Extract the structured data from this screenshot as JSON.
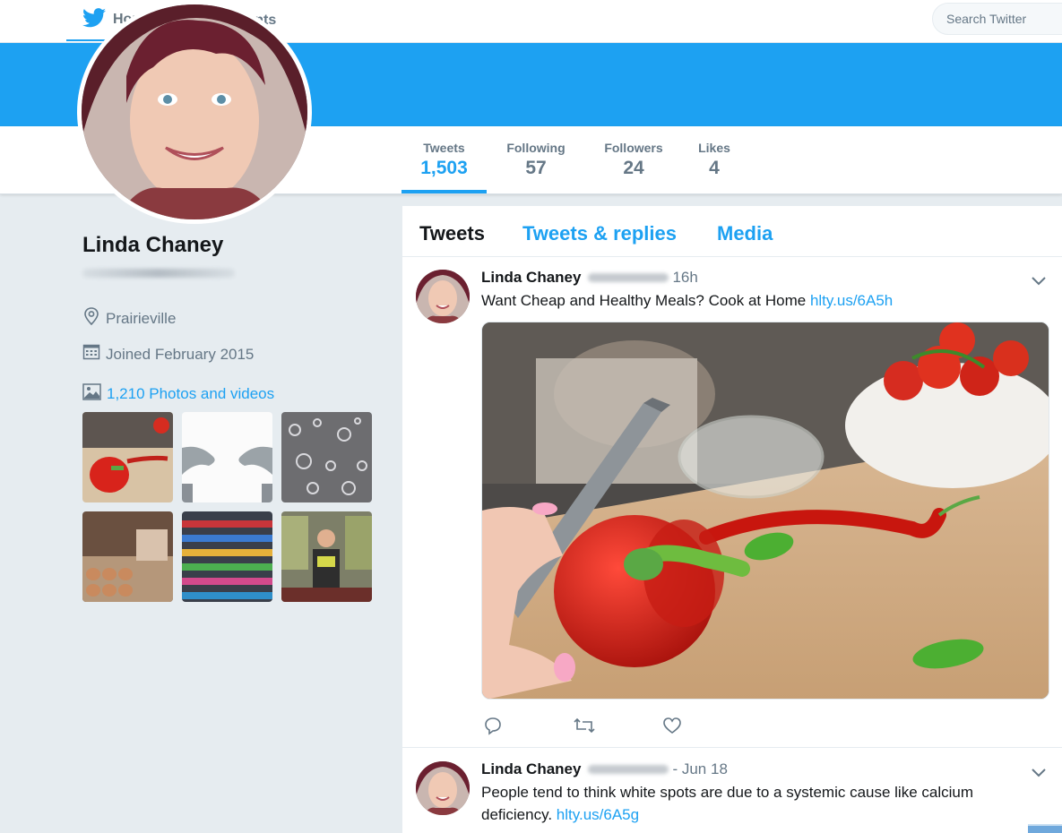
{
  "nav": {
    "home_label": "Home",
    "moments_label": "Moments",
    "search_placeholder": "Search Twitter"
  },
  "stats": [
    {
      "label": "Tweets",
      "value": "1,503"
    },
    {
      "label": "Following",
      "value": "57"
    },
    {
      "label": "Followers",
      "value": "24"
    },
    {
      "label": "Likes",
      "value": "4"
    }
  ],
  "profile": {
    "name": "Linda Chaney",
    "location": "Prairieville",
    "joined": "Joined February 2015",
    "photos_link": "1,210 Photos and videos"
  },
  "timeline": {
    "tabs": [
      "Tweets",
      "Tweets & replies",
      "Media"
    ],
    "tweets": [
      {
        "name": "Linda Chaney",
        "time": "16h",
        "text": "Want Cheap and Healthy Meals? Cook at Home ",
        "link": "hlty.us/6A5h"
      },
      {
        "name": "Linda Chaney",
        "time": "- Jun 18",
        "text": "People tend to think white spots are due to a systemic cause like calcium deficiency. ",
        "link": "hlty.us/6A5g"
      }
    ]
  },
  "colors": {
    "accent": "#1da1f2",
    "muted": "#657786",
    "background": "#e6ecf0"
  }
}
